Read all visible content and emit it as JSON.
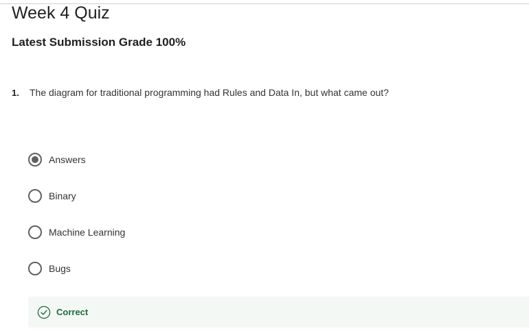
{
  "quiz": {
    "title": "Week 4 Quiz",
    "grade_text": "Latest Submission Grade 100%"
  },
  "question": {
    "number": "1.",
    "text": "The diagram for traditional programming had Rules and Data In, but what came out?",
    "options": [
      {
        "label": "Answers",
        "selected": true
      },
      {
        "label": "Binary",
        "selected": false
      },
      {
        "label": "Machine Learning",
        "selected": false
      },
      {
        "label": "Bugs",
        "selected": false
      }
    ],
    "feedback": {
      "label": "Correct",
      "icon": "check-circle-icon",
      "color": "#1f6b3a",
      "background": "#f3f8f5"
    }
  }
}
